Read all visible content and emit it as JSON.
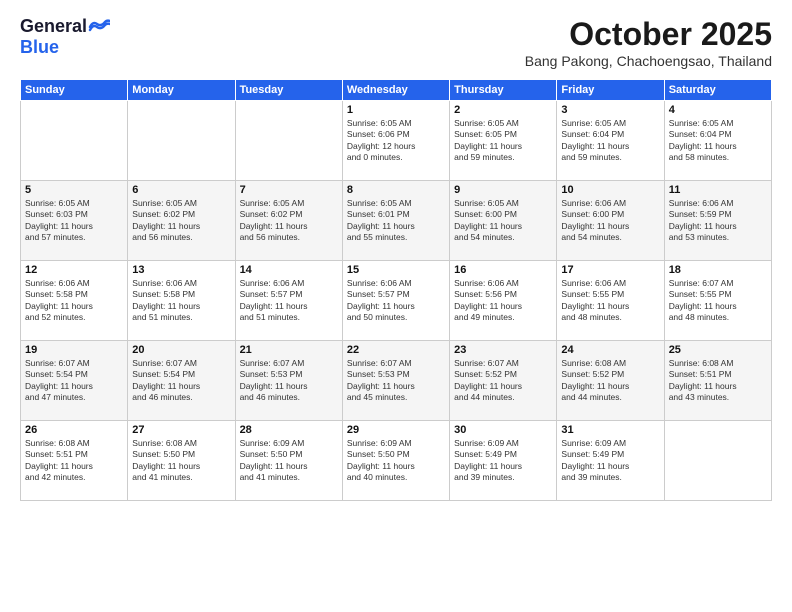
{
  "logo": {
    "general": "General",
    "blue": "Blue"
  },
  "header": {
    "month": "October 2025",
    "location": "Bang Pakong, Chachoengsao, Thailand"
  },
  "weekdays": [
    "Sunday",
    "Monday",
    "Tuesday",
    "Wednesday",
    "Thursday",
    "Friday",
    "Saturday"
  ],
  "weeks": [
    [
      {
        "day": "",
        "info": ""
      },
      {
        "day": "",
        "info": ""
      },
      {
        "day": "",
        "info": ""
      },
      {
        "day": "1",
        "info": "Sunrise: 6:05 AM\nSunset: 6:06 PM\nDaylight: 12 hours\nand 0 minutes."
      },
      {
        "day": "2",
        "info": "Sunrise: 6:05 AM\nSunset: 6:05 PM\nDaylight: 11 hours\nand 59 minutes."
      },
      {
        "day": "3",
        "info": "Sunrise: 6:05 AM\nSunset: 6:04 PM\nDaylight: 11 hours\nand 59 minutes."
      },
      {
        "day": "4",
        "info": "Sunrise: 6:05 AM\nSunset: 6:04 PM\nDaylight: 11 hours\nand 58 minutes."
      }
    ],
    [
      {
        "day": "5",
        "info": "Sunrise: 6:05 AM\nSunset: 6:03 PM\nDaylight: 11 hours\nand 57 minutes."
      },
      {
        "day": "6",
        "info": "Sunrise: 6:05 AM\nSunset: 6:02 PM\nDaylight: 11 hours\nand 56 minutes."
      },
      {
        "day": "7",
        "info": "Sunrise: 6:05 AM\nSunset: 6:02 PM\nDaylight: 11 hours\nand 56 minutes."
      },
      {
        "day": "8",
        "info": "Sunrise: 6:05 AM\nSunset: 6:01 PM\nDaylight: 11 hours\nand 55 minutes."
      },
      {
        "day": "9",
        "info": "Sunrise: 6:05 AM\nSunset: 6:00 PM\nDaylight: 11 hours\nand 54 minutes."
      },
      {
        "day": "10",
        "info": "Sunrise: 6:06 AM\nSunset: 6:00 PM\nDaylight: 11 hours\nand 54 minutes."
      },
      {
        "day": "11",
        "info": "Sunrise: 6:06 AM\nSunset: 5:59 PM\nDaylight: 11 hours\nand 53 minutes."
      }
    ],
    [
      {
        "day": "12",
        "info": "Sunrise: 6:06 AM\nSunset: 5:58 PM\nDaylight: 11 hours\nand 52 minutes."
      },
      {
        "day": "13",
        "info": "Sunrise: 6:06 AM\nSunset: 5:58 PM\nDaylight: 11 hours\nand 51 minutes."
      },
      {
        "day": "14",
        "info": "Sunrise: 6:06 AM\nSunset: 5:57 PM\nDaylight: 11 hours\nand 51 minutes."
      },
      {
        "day": "15",
        "info": "Sunrise: 6:06 AM\nSunset: 5:57 PM\nDaylight: 11 hours\nand 50 minutes."
      },
      {
        "day": "16",
        "info": "Sunrise: 6:06 AM\nSunset: 5:56 PM\nDaylight: 11 hours\nand 49 minutes."
      },
      {
        "day": "17",
        "info": "Sunrise: 6:06 AM\nSunset: 5:55 PM\nDaylight: 11 hours\nand 48 minutes."
      },
      {
        "day": "18",
        "info": "Sunrise: 6:07 AM\nSunset: 5:55 PM\nDaylight: 11 hours\nand 48 minutes."
      }
    ],
    [
      {
        "day": "19",
        "info": "Sunrise: 6:07 AM\nSunset: 5:54 PM\nDaylight: 11 hours\nand 47 minutes."
      },
      {
        "day": "20",
        "info": "Sunrise: 6:07 AM\nSunset: 5:54 PM\nDaylight: 11 hours\nand 46 minutes."
      },
      {
        "day": "21",
        "info": "Sunrise: 6:07 AM\nSunset: 5:53 PM\nDaylight: 11 hours\nand 46 minutes."
      },
      {
        "day": "22",
        "info": "Sunrise: 6:07 AM\nSunset: 5:53 PM\nDaylight: 11 hours\nand 45 minutes."
      },
      {
        "day": "23",
        "info": "Sunrise: 6:07 AM\nSunset: 5:52 PM\nDaylight: 11 hours\nand 44 minutes."
      },
      {
        "day": "24",
        "info": "Sunrise: 6:08 AM\nSunset: 5:52 PM\nDaylight: 11 hours\nand 44 minutes."
      },
      {
        "day": "25",
        "info": "Sunrise: 6:08 AM\nSunset: 5:51 PM\nDaylight: 11 hours\nand 43 minutes."
      }
    ],
    [
      {
        "day": "26",
        "info": "Sunrise: 6:08 AM\nSunset: 5:51 PM\nDaylight: 11 hours\nand 42 minutes."
      },
      {
        "day": "27",
        "info": "Sunrise: 6:08 AM\nSunset: 5:50 PM\nDaylight: 11 hours\nand 41 minutes."
      },
      {
        "day": "28",
        "info": "Sunrise: 6:09 AM\nSunset: 5:50 PM\nDaylight: 11 hours\nand 41 minutes."
      },
      {
        "day": "29",
        "info": "Sunrise: 6:09 AM\nSunset: 5:50 PM\nDaylight: 11 hours\nand 40 minutes."
      },
      {
        "day": "30",
        "info": "Sunrise: 6:09 AM\nSunset: 5:49 PM\nDaylight: 11 hours\nand 39 minutes."
      },
      {
        "day": "31",
        "info": "Sunrise: 6:09 AM\nSunset: 5:49 PM\nDaylight: 11 hours\nand 39 minutes."
      },
      {
        "day": "",
        "info": ""
      }
    ]
  ]
}
